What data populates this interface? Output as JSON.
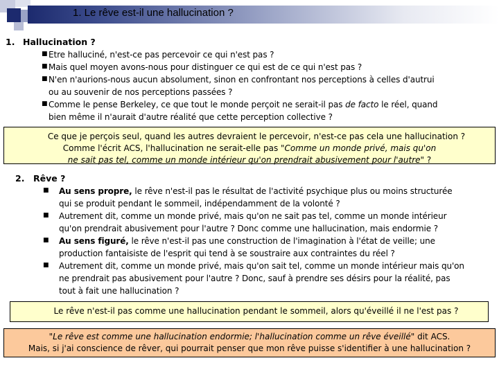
{
  "header": {
    "title": "1. Le rêve est-il une hallucination ?"
  },
  "colors": {
    "title_gradient_start": "#1c2a6e",
    "box_yellow": "#ffffcc",
    "box_orange": "#fcc99c"
  },
  "section1": {
    "number": "1.",
    "heading": "Hallucination ?",
    "bullets": [
      {
        "lines": [
          "Etre halluciné, n'est-ce pas percevoir ce qui n'est pas ?"
        ]
      },
      {
        "lines": [
          "Mais quel moyen avons-nous pour distinguer ce qui est de ce qui n'est pas ?"
        ]
      },
      {
        "lines": [
          "N'en n'aurions-nous aucun absolument, sinon en confrontant nos perceptions à celles d'autrui",
          "ou au souvenir de nos perceptions passées ?"
        ]
      },
      {
        "pre": "Comme le pense Berkeley, ce que tout le monde perçoit ne serait-il  pas ",
        "em": "de facto",
        "post": " le réel, quand",
        "line2": "bien même il n'aurait d'autre réalité que cette perception collective ?"
      }
    ]
  },
  "box1": {
    "line1": "Ce que je perçois seul, quand les autres devraient le percevoir, n'est-ce pas cela une hallucination ?",
    "line2_pre": "Comme l'écrit ACS, l'hallucination ne serait-elle pas ",
    "line2_em": "\"Comme un monde privé, mais qu'on",
    "line3_em": "ne sait pas tel, comme un monde intérieur qu'on prendrait abusivement pour l'autre\"",
    "line3_post": " ?"
  },
  "section2": {
    "number": "2.",
    "heading": "Rêve ?",
    "bullets": [
      {
        "strong": "Au sens propre,",
        "rest": " le rêve n'est-il pas le résultat de l'activité psychique plus ou moins structurée",
        "lines": [
          "qui se produit pendant le sommeil, indépendamment de la volonté ?"
        ]
      },
      {
        "rest": "Autrement dit, comme un monde privé, mais qu'on ne sait pas tel, comme un monde intérieur",
        "lines": [
          "qu'on prendrait abusivement pour l'autre ? Donc comme une hallucination, mais endormie ?"
        ]
      },
      {
        "strong": "Au sens figuré,",
        "rest": " le rêve n'est-il pas une construction de l'imagination à l'état de veille; une",
        "lines": [
          "production fantaisiste de l'esprit qui tend à se soustraire aux contraintes du réel ?"
        ]
      },
      {
        "rest": "Autrement dit, comme un monde privé, mais qu'on sait tel, comme un monde intérieur mais qu'on",
        "lines": [
          "ne prendrait pas abusivement pour l'autre ? Donc, sauf à prendre ses désirs pour la réalité, pas",
          "tout à fait une hallucination ?"
        ]
      }
    ]
  },
  "box2": {
    "text": "Le rêve n'est-il pas comme une hallucination pendant le sommeil, alors qu'éveillé il ne l'est pas ?"
  },
  "box3": {
    "line1_em": "\"Le rêve est comme une hallucination endormie; l'hallucination comme un rêve éveillé\"",
    "line1_post": " dit ACS.",
    "line2": "Mais, si j'ai conscience de rêver, qui pourrait penser que mon rêve puisse s'identifier à une hallucination ?"
  }
}
